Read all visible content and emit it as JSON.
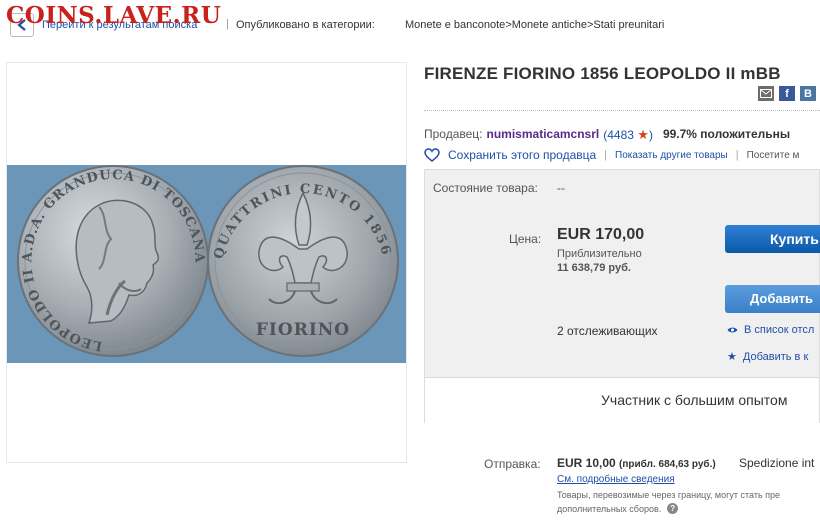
{
  "watermark": "COINS.LAVE.RU",
  "topbar": {
    "back_link": "Перейти к результатам поиска",
    "separator": "|",
    "category_label": "Опубликовано в категории:",
    "breadcrumbs": [
      "Monete e banconote",
      "Monete antiche",
      "Stati preunitari"
    ],
    "breadcrumb_sep": ">"
  },
  "coin": {
    "obverse_legend": "LEOPOLDO II A.D.A. GRANDUCA DI TOSCANA",
    "reverse_legend": "QUATTRINI CENTO 1856",
    "reverse_text": "FIORINO"
  },
  "listing": {
    "title": "FIRENZE FIORINO 1856 LEOPOLDO II mBB",
    "share_icons": [
      "mail-icon",
      "facebook-icon",
      "vk-icon"
    ],
    "share_vk_letter": "B"
  },
  "seller": {
    "label": "Продавец:",
    "name": "numismaticamcnsrl",
    "score": "(4483",
    "score_close": ")",
    "positive": "99.7% положительны"
  },
  "save": {
    "save_label": "Сохранить этого продавца",
    "other_items": "Показать другие товары",
    "visit": "Посетите м"
  },
  "buy_panel": {
    "condition_label": "Состояние товара:",
    "condition_value": "--",
    "price_label": "Цена:",
    "price": "EUR 170,00",
    "approx_label": "Приблизительно",
    "approx_value": "11 638,79 руб.",
    "buy_button": "Купить",
    "add_button": "Добавить",
    "watchers": "2 отслеживающих",
    "watch_link": "В список отсл",
    "add_to_link": "Добавить в к",
    "buyer_tip": "Участник с большим опытом"
  },
  "shipping": {
    "label": "Отправка:",
    "price": "EUR 10,00",
    "approx": "(прибл. 684,63 руб.)",
    "destination": "Spedizione int",
    "details_link": "См. подробные сведения",
    "note_line1": "Товары, перевозимые через границу, могут стать пре",
    "note_line2": "дополнительных сборов."
  },
  "colors": {
    "link": "#1e4fa8",
    "seller_name": "#5b2a86",
    "buy_button": "#0b5aa9",
    "add_button": "#3b7fc7",
    "watermark": "#c9211c",
    "photo_background": "#6c96b8"
  }
}
